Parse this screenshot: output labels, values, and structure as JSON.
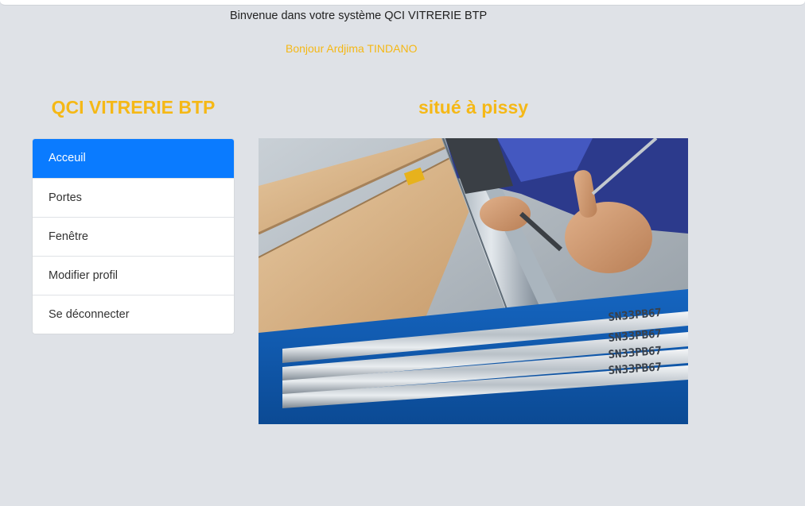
{
  "header": {
    "welcome": "Binvenue dans votre système QCI VITRERIE BTP",
    "greeting": "Bonjour Ardjima TINDANO"
  },
  "sidebar": {
    "brand": "QCI VITRERIE BTP",
    "items": [
      {
        "label": "Acceuil",
        "active": true
      },
      {
        "label": "Portes",
        "active": false
      },
      {
        "label": "Fenêtre",
        "active": false
      },
      {
        "label": "Modifier profil",
        "active": false
      },
      {
        "label": "Se déconnecter",
        "active": false
      }
    ]
  },
  "main": {
    "subtitle": "situé à pissy",
    "image": {
      "description": "photo of a worker soldering a zinc roof gutter with tin-lead solder bars",
      "bar_markings": [
        "SN33PB67",
        "SN33PB67",
        "SN33PB67",
        "SN33PB67"
      ]
    }
  },
  "colors": {
    "background": "#dfe2e7",
    "accent": "#f5b816",
    "active": "#0a7bff",
    "menu_text": "#333333"
  }
}
